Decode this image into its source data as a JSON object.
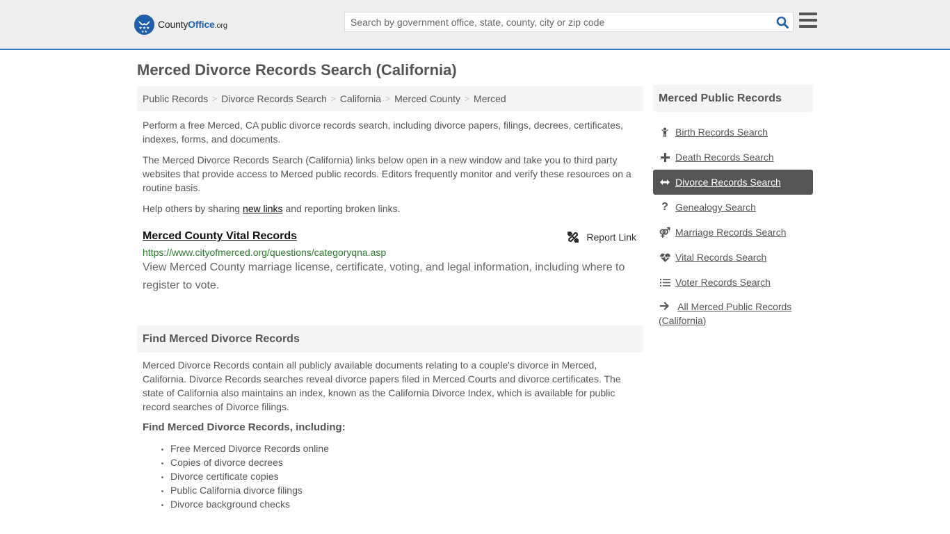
{
  "header": {
    "logo": {
      "county": "County",
      "office": "Office",
      "org": ".org"
    },
    "search_placeholder": "Search by government office, state, county, city or zip code",
    "colors": {
      "accent": "#337ab7",
      "logo_blue": "#1f5ea8",
      "header_bg": "#eeeeee"
    }
  },
  "page_title": "Merced Divorce Records Search (California)",
  "breadcrumb": [
    {
      "label": "Public Records"
    },
    {
      "label": "Divorce Records Search"
    },
    {
      "label": "California"
    },
    {
      "label": "Merced County"
    },
    {
      "label": "Merced"
    }
  ],
  "breadcrumb_separator": ">",
  "intro": {
    "p1": "Perform a free Merced, CA public divorce records search, including divorce papers, filings, decrees, certificates, indexes, forms, and documents.",
    "p2": "The Merced Divorce Records Search (California) links below open in a new window and take you to third party websites that provide access to Merced public records. Editors frequently monitor and verify these resources on a routine basis.",
    "p3_before": "Help others by sharing ",
    "p3_link": "new links",
    "p3_after": " and reporting broken links."
  },
  "listings": [
    {
      "title": "Merced County Vital Records",
      "url": "https://www.cityofmerced.org/questions/categoryqna.asp",
      "description": "View Merced County marriage license, certificate, voting, and legal information, including where to register to vote.",
      "report_label": "Report Link"
    }
  ],
  "find_section": {
    "heading": "Find Merced Divorce Records",
    "body": "Merced Divorce Records contain all publicly available documents relating to a couple's divorce in Merced, California. Divorce Records searches reveal divorce papers filed in Merced Courts and divorce certificates. The state of California also maintains an index, known as the California Divorce Index, which is available for public record searches of Divorce filings.",
    "subheading": "Find Merced Divorce Records, including:",
    "items": [
      "Free Merced Divorce Records online",
      "Copies of divorce decrees",
      "Divorce certificate copies",
      "Public California divorce filings",
      "Divorce background checks"
    ]
  },
  "sidebar": {
    "heading": "Merced Public Records",
    "items": [
      {
        "label": "Birth Records Search",
        "icon": "child-icon",
        "active": false
      },
      {
        "label": "Death Records Search",
        "icon": "cross-icon",
        "active": false
      },
      {
        "label": "Divorce Records Search",
        "icon": "arrows-horizontal-icon",
        "active": true
      },
      {
        "label": "Genealogy Search",
        "icon": "question-icon",
        "active": false
      },
      {
        "label": "Marriage Records Search",
        "icon": "venus-mars-icon",
        "active": false
      },
      {
        "label": "Vital Records Search",
        "icon": "heartbeat-icon",
        "active": false
      },
      {
        "label": "Voter Records Search",
        "icon": "list-ol-icon",
        "active": false
      },
      {
        "label": "All Merced Public Records (California)",
        "icon": "arrow-right-icon",
        "active": false
      }
    ]
  }
}
